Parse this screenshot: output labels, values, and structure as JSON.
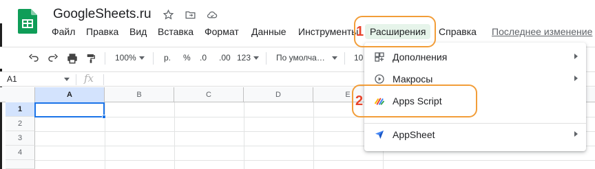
{
  "app": {
    "title": "GoogleSheets.ru"
  },
  "menubar": {
    "items": [
      "Файл",
      "Правка",
      "Вид",
      "Вставка",
      "Формат",
      "Данные",
      "Инструменты",
      "Расширения",
      "Справка"
    ],
    "last_edit": "Последнее изменение"
  },
  "toolbar": {
    "zoom": "100%",
    "currency": "р.",
    "percent": "%",
    "dec_less": ".0",
    "dec_more": ".00",
    "more_formats": "123",
    "font": "По умолча…",
    "font_size": "10"
  },
  "formula": {
    "cell_ref": "A1",
    "fx": "fx"
  },
  "grid": {
    "columns": [
      "A",
      "B",
      "C",
      "D",
      "E"
    ],
    "rows": [
      "1",
      "2",
      "3",
      "4"
    ]
  },
  "menu": {
    "items": [
      {
        "label": "Дополнения",
        "icon": "addons-icon",
        "submenu": true
      },
      {
        "label": "Макросы",
        "icon": "macros-icon",
        "submenu": true
      },
      {
        "label": "Apps Script",
        "icon": "apps-script-icon",
        "submenu": false
      },
      {
        "label": "AppSheet",
        "icon": "appsheet-icon",
        "submenu": true
      }
    ]
  },
  "callouts": {
    "first": "1",
    "second": "2"
  },
  "colors": {
    "accent": "#1a73e8",
    "sheets_green": "#0f9d58",
    "callout_orange": "#f29d38",
    "callout_number": "#e8452c",
    "menu_active_bg": "#e6f4ea"
  }
}
